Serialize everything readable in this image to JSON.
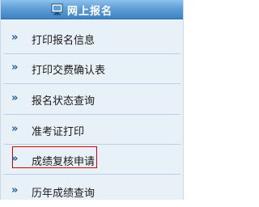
{
  "header": {
    "title": "网上报名",
    "icon": "monitor-icon"
  },
  "menu": {
    "items": [
      {
        "label": "打印报名信息"
      },
      {
        "label": "打印交费确认表"
      },
      {
        "label": "报名状态查询"
      },
      {
        "label": "准考证打印"
      },
      {
        "label": "成绩复核申请"
      },
      {
        "label": "历年成绩查询"
      }
    ],
    "chevron": "»"
  },
  "colors": {
    "header": "#4f91cc",
    "highlight_border": "#d40000",
    "chevron": "#1e5a98",
    "background": "#e9f1f8"
  }
}
